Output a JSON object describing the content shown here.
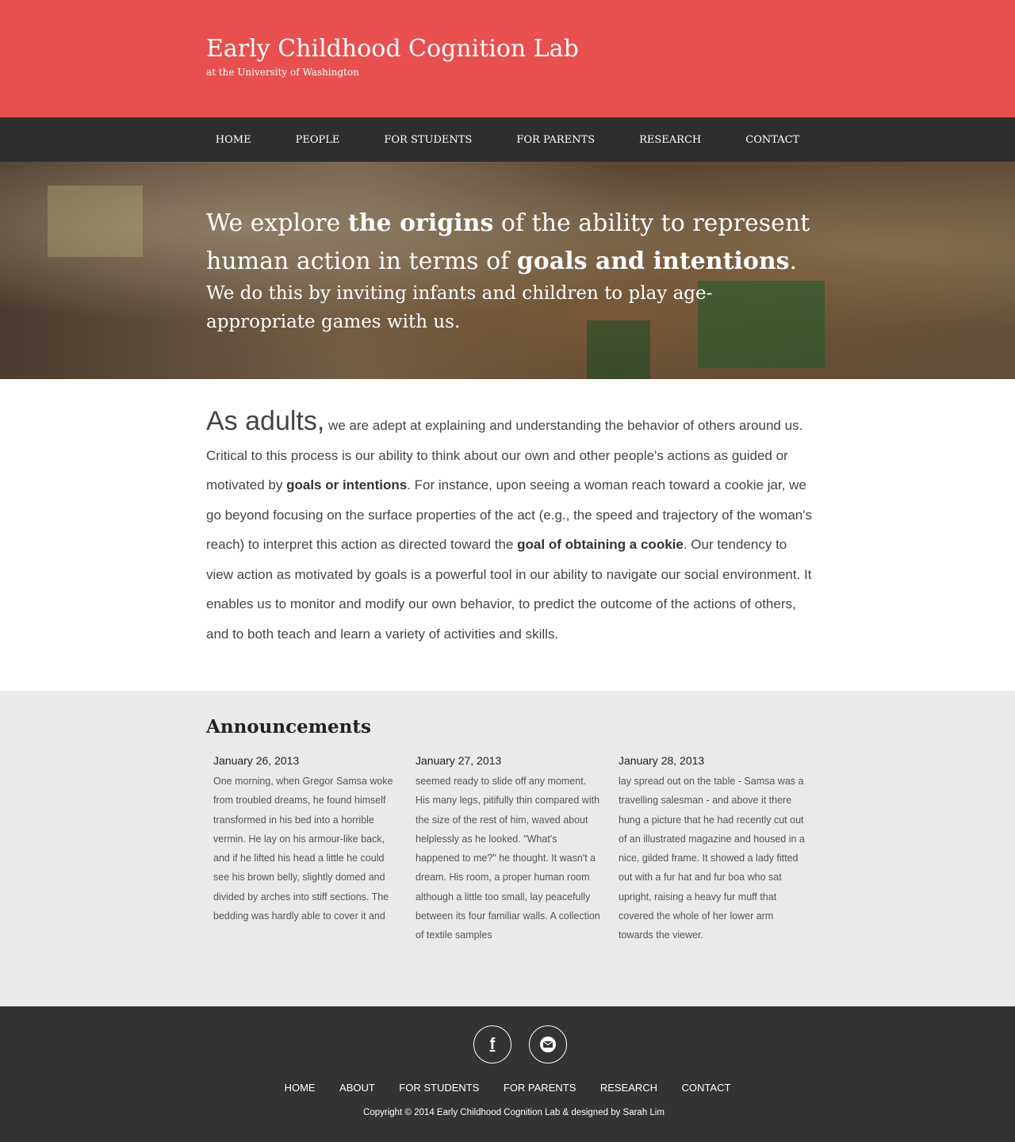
{
  "header": {
    "title": "Early Childhood Cognition Lab",
    "subtitle": "at the University of Washington",
    "bg_color": "#e85050"
  },
  "topnav": {
    "items": [
      "HOME",
      "PEOPLE",
      "FOR STUDENTS",
      "FOR PARENTS",
      "RESEARCH",
      "CONTACT"
    ]
  },
  "hero": {
    "line1_pre": "We explore ",
    "line1_bold": "the origins",
    "line1_post": " of the ability to represent",
    "line2_pre": "human action in terms of ",
    "line2_bold": "goals and intentions",
    "line2_post": ".",
    "line3": "We do this by inviting infants and children to play age-appropriate games with us."
  },
  "intro": {
    "lead": "As adults,",
    "part1": " we are adept at explaining and understanding the behavior of others around us. Critical to this process is our ability to think about our own and other people's actions as guided or motivated by ",
    "bold1": "goals or intentions",
    "part2": ". For instance, upon seeing a woman reach toward a cookie jar, we go beyond focusing on the surface properties of the act (e.g., the speed and trajectory of the woman's reach) to interpret this action as directed toward the ",
    "bold2": "goal of obtaining a cookie",
    "part3": ". Our tendency to view action as motivated by goals is a powerful tool in our ability to navigate our social environment. It enables us to monitor and modify our own behavior, to predict the outcome of the actions of others, and to both teach and learn a variety of activities and skills."
  },
  "announcements": {
    "title": "Announcements",
    "items": [
      {
        "date": "January 26, 2013",
        "text": "One morning, when Gregor Samsa woke from troubled dreams, he found himself transformed in his bed into a horrible vermin. He lay on his armour-like back, and if he lifted his head a little he could see his brown belly, slightly domed and divided by arches into stiff sections. The bedding was hardly able to cover it and"
      },
      {
        "date": "January 27, 2013",
        "text": "seemed ready to slide off any moment. His many legs, pitifully thin compared with the size of the rest of him, waved about helplessly as he looked. \"What's happened to me?\" he thought. It wasn't a dream. His room, a proper human room although a little too small, lay peacefully between its four familiar walls. A collection of textile samples"
      },
      {
        "date": "January 28, 2013",
        "text": "lay spread out on the table - Samsa was a travelling salesman - and above it there hung a picture that he had recently cut out of an illustrated magazine and housed in a nice, gilded frame. It showed a lady fitted out with a fur hat and fur boa who sat upright, raising a heavy fur muff that covered the whole of her lower arm towards the viewer."
      }
    ]
  },
  "footer": {
    "social": [
      {
        "icon": "facebook-icon",
        "glyph": "f"
      },
      {
        "icon": "email-icon",
        "glyph": "✉"
      }
    ],
    "nav": [
      "HOME",
      "ABOUT",
      "FOR STUDENTS",
      "FOR PARENTS",
      "RESEARCH",
      "CONTACT"
    ],
    "copyright": "Copyright © 2014 Early Childhood Cognition Lab & designed by Sarah Lim"
  }
}
